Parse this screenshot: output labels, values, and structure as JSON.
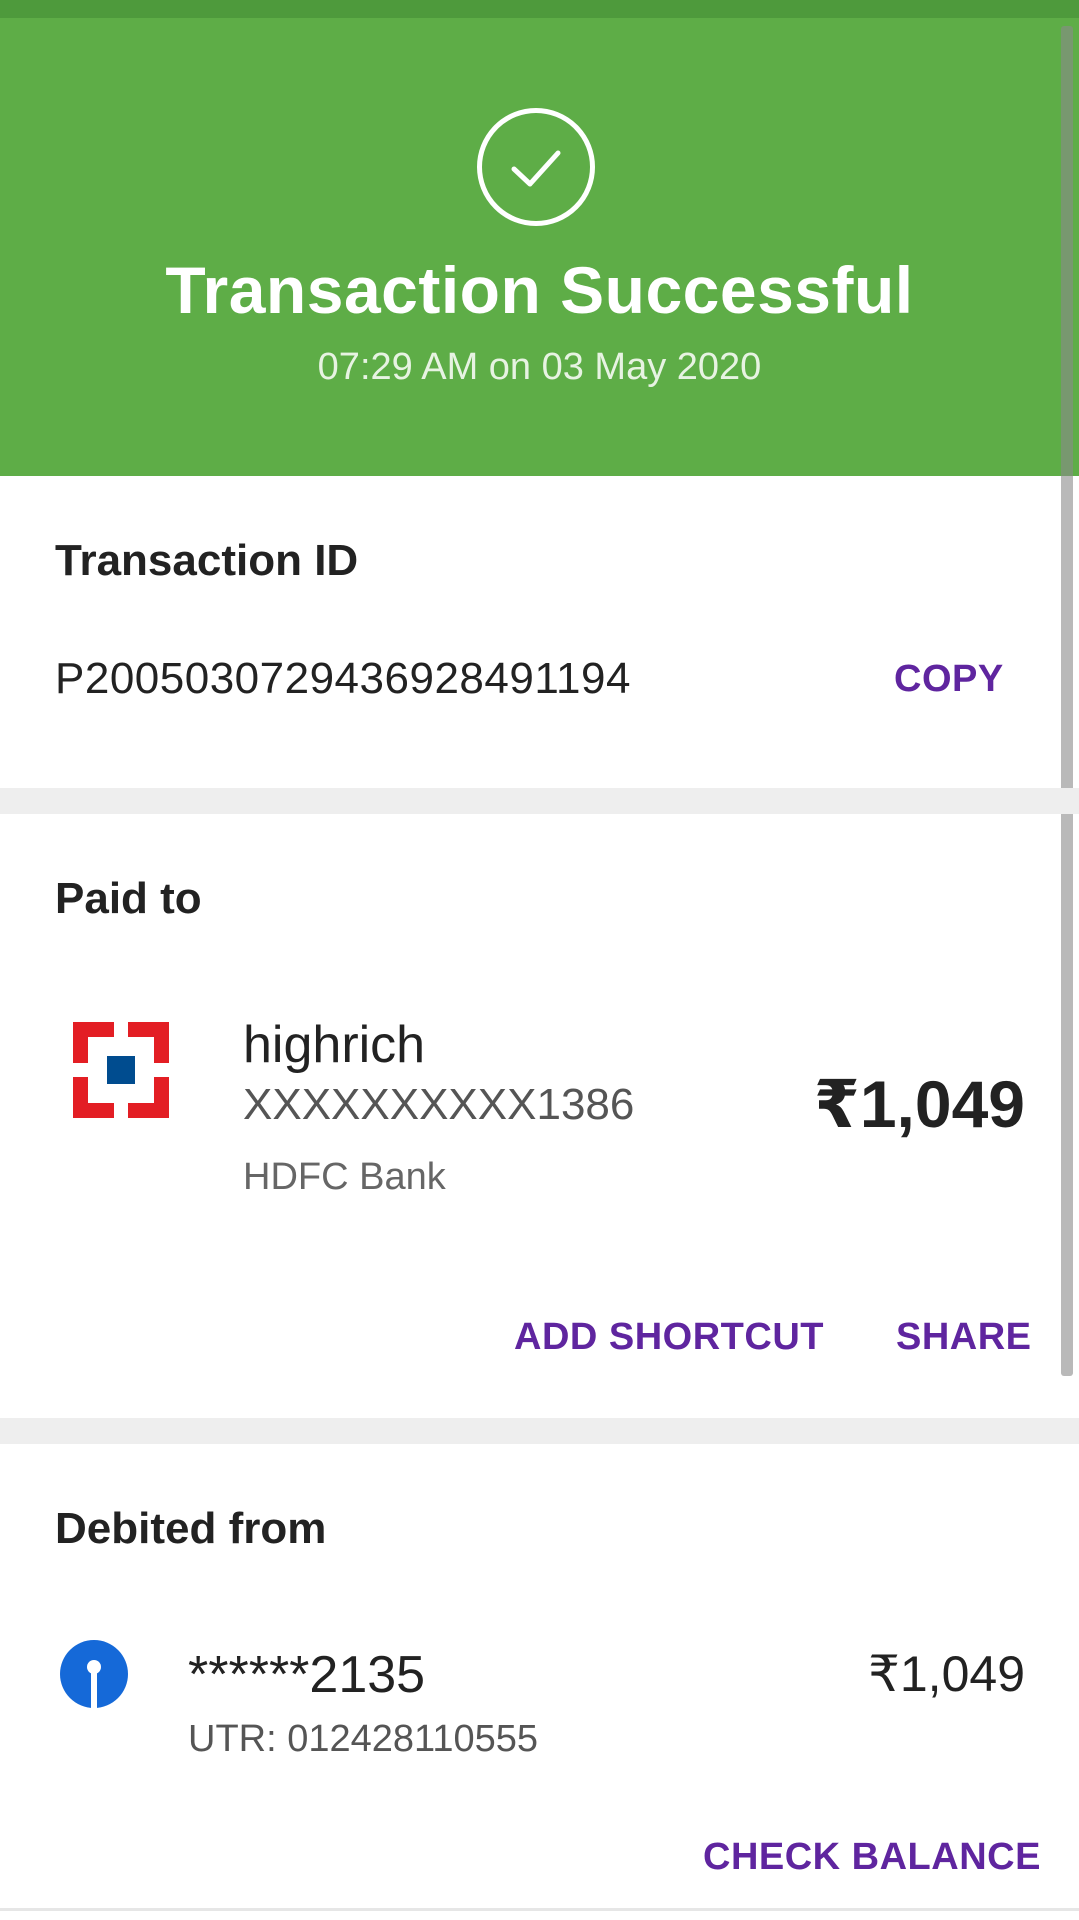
{
  "colors": {
    "header_bg": "#5ead47",
    "accent": "#5f259f",
    "hdfc_red": "#e31e24",
    "hdfc_blue": "#004c8f",
    "sbi_blue": "#1569d8"
  },
  "header": {
    "icon": "check-circle-icon",
    "title": "Transaction Successful",
    "subtitle": "07:29 AM on 03 May 2020"
  },
  "transaction": {
    "section_label": "Transaction ID",
    "id": "P2005030729436928491194",
    "copy_label": "COPY"
  },
  "paid_to": {
    "section_label": "Paid to",
    "bank_icon": "hdfc-bank-logo",
    "name": "highrich",
    "account": "XXXXXXXXXX1386",
    "bank": "HDFC Bank",
    "amount": "₹1,049",
    "add_shortcut_label": "ADD SHORTCUT",
    "share_label": "SHARE"
  },
  "debited_from": {
    "section_label": "Debited from",
    "bank_icon": "sbi-logo",
    "account": "******2135",
    "utr": "UTR: 012428110555",
    "amount": "₹1,049",
    "check_balance_label": "CHECK BALANCE"
  }
}
